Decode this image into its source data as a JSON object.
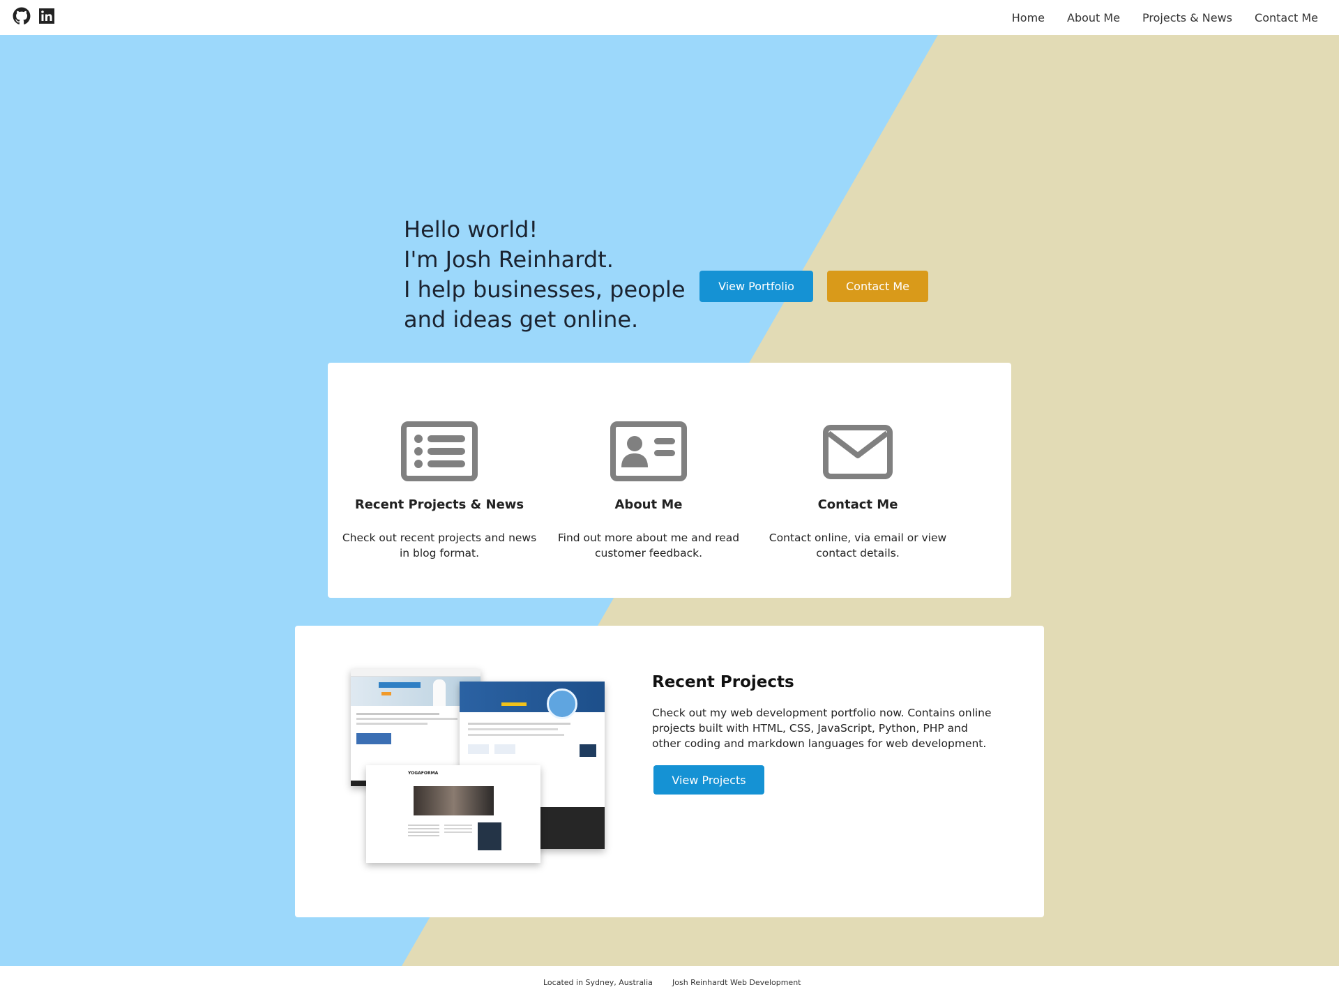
{
  "social": {
    "github_icon": "github-icon",
    "linkedin_icon": "linkedin-icon"
  },
  "nav": {
    "items": [
      {
        "label": "Home"
      },
      {
        "label": "About Me"
      },
      {
        "label": "Projects & News"
      },
      {
        "label": "Contact Me"
      }
    ]
  },
  "hero": {
    "lines": [
      "Hello world!",
      "I'm Josh Reinhardt.",
      "I help businesses, people",
      "and ideas get online."
    ],
    "primary_button": "View Portfolio",
    "secondary_button": "Contact Me"
  },
  "features": [
    {
      "icon": "list-icon",
      "title": "Recent Projects & News",
      "description": "Check out recent projects and news in blog format."
    },
    {
      "icon": "id-card-icon",
      "title": "About Me",
      "description": "Find out more about me and read customer feedback."
    },
    {
      "icon": "envelope-icon",
      "title": "Contact Me",
      "description": "Contact online, via email or view contact details."
    }
  ],
  "projects": {
    "title": "Recent Projects",
    "description": "Check out my web development portfolio now. Contains online projects built with HTML, CSS, JavaScript, Python, PHP and other coding and markdown languages for web development.",
    "button": "View Projects",
    "image_label": "YOGAFORMA"
  },
  "footer": {
    "location": "Located in Sydney, Australia",
    "brand": "Josh Reinhardt Web Development"
  },
  "colors": {
    "sky": "#9cd8fb",
    "sand": "#e2dbb5",
    "blue_button": "#1592d4",
    "gold_button": "#d99a1a",
    "icon_gray": "#808080"
  }
}
